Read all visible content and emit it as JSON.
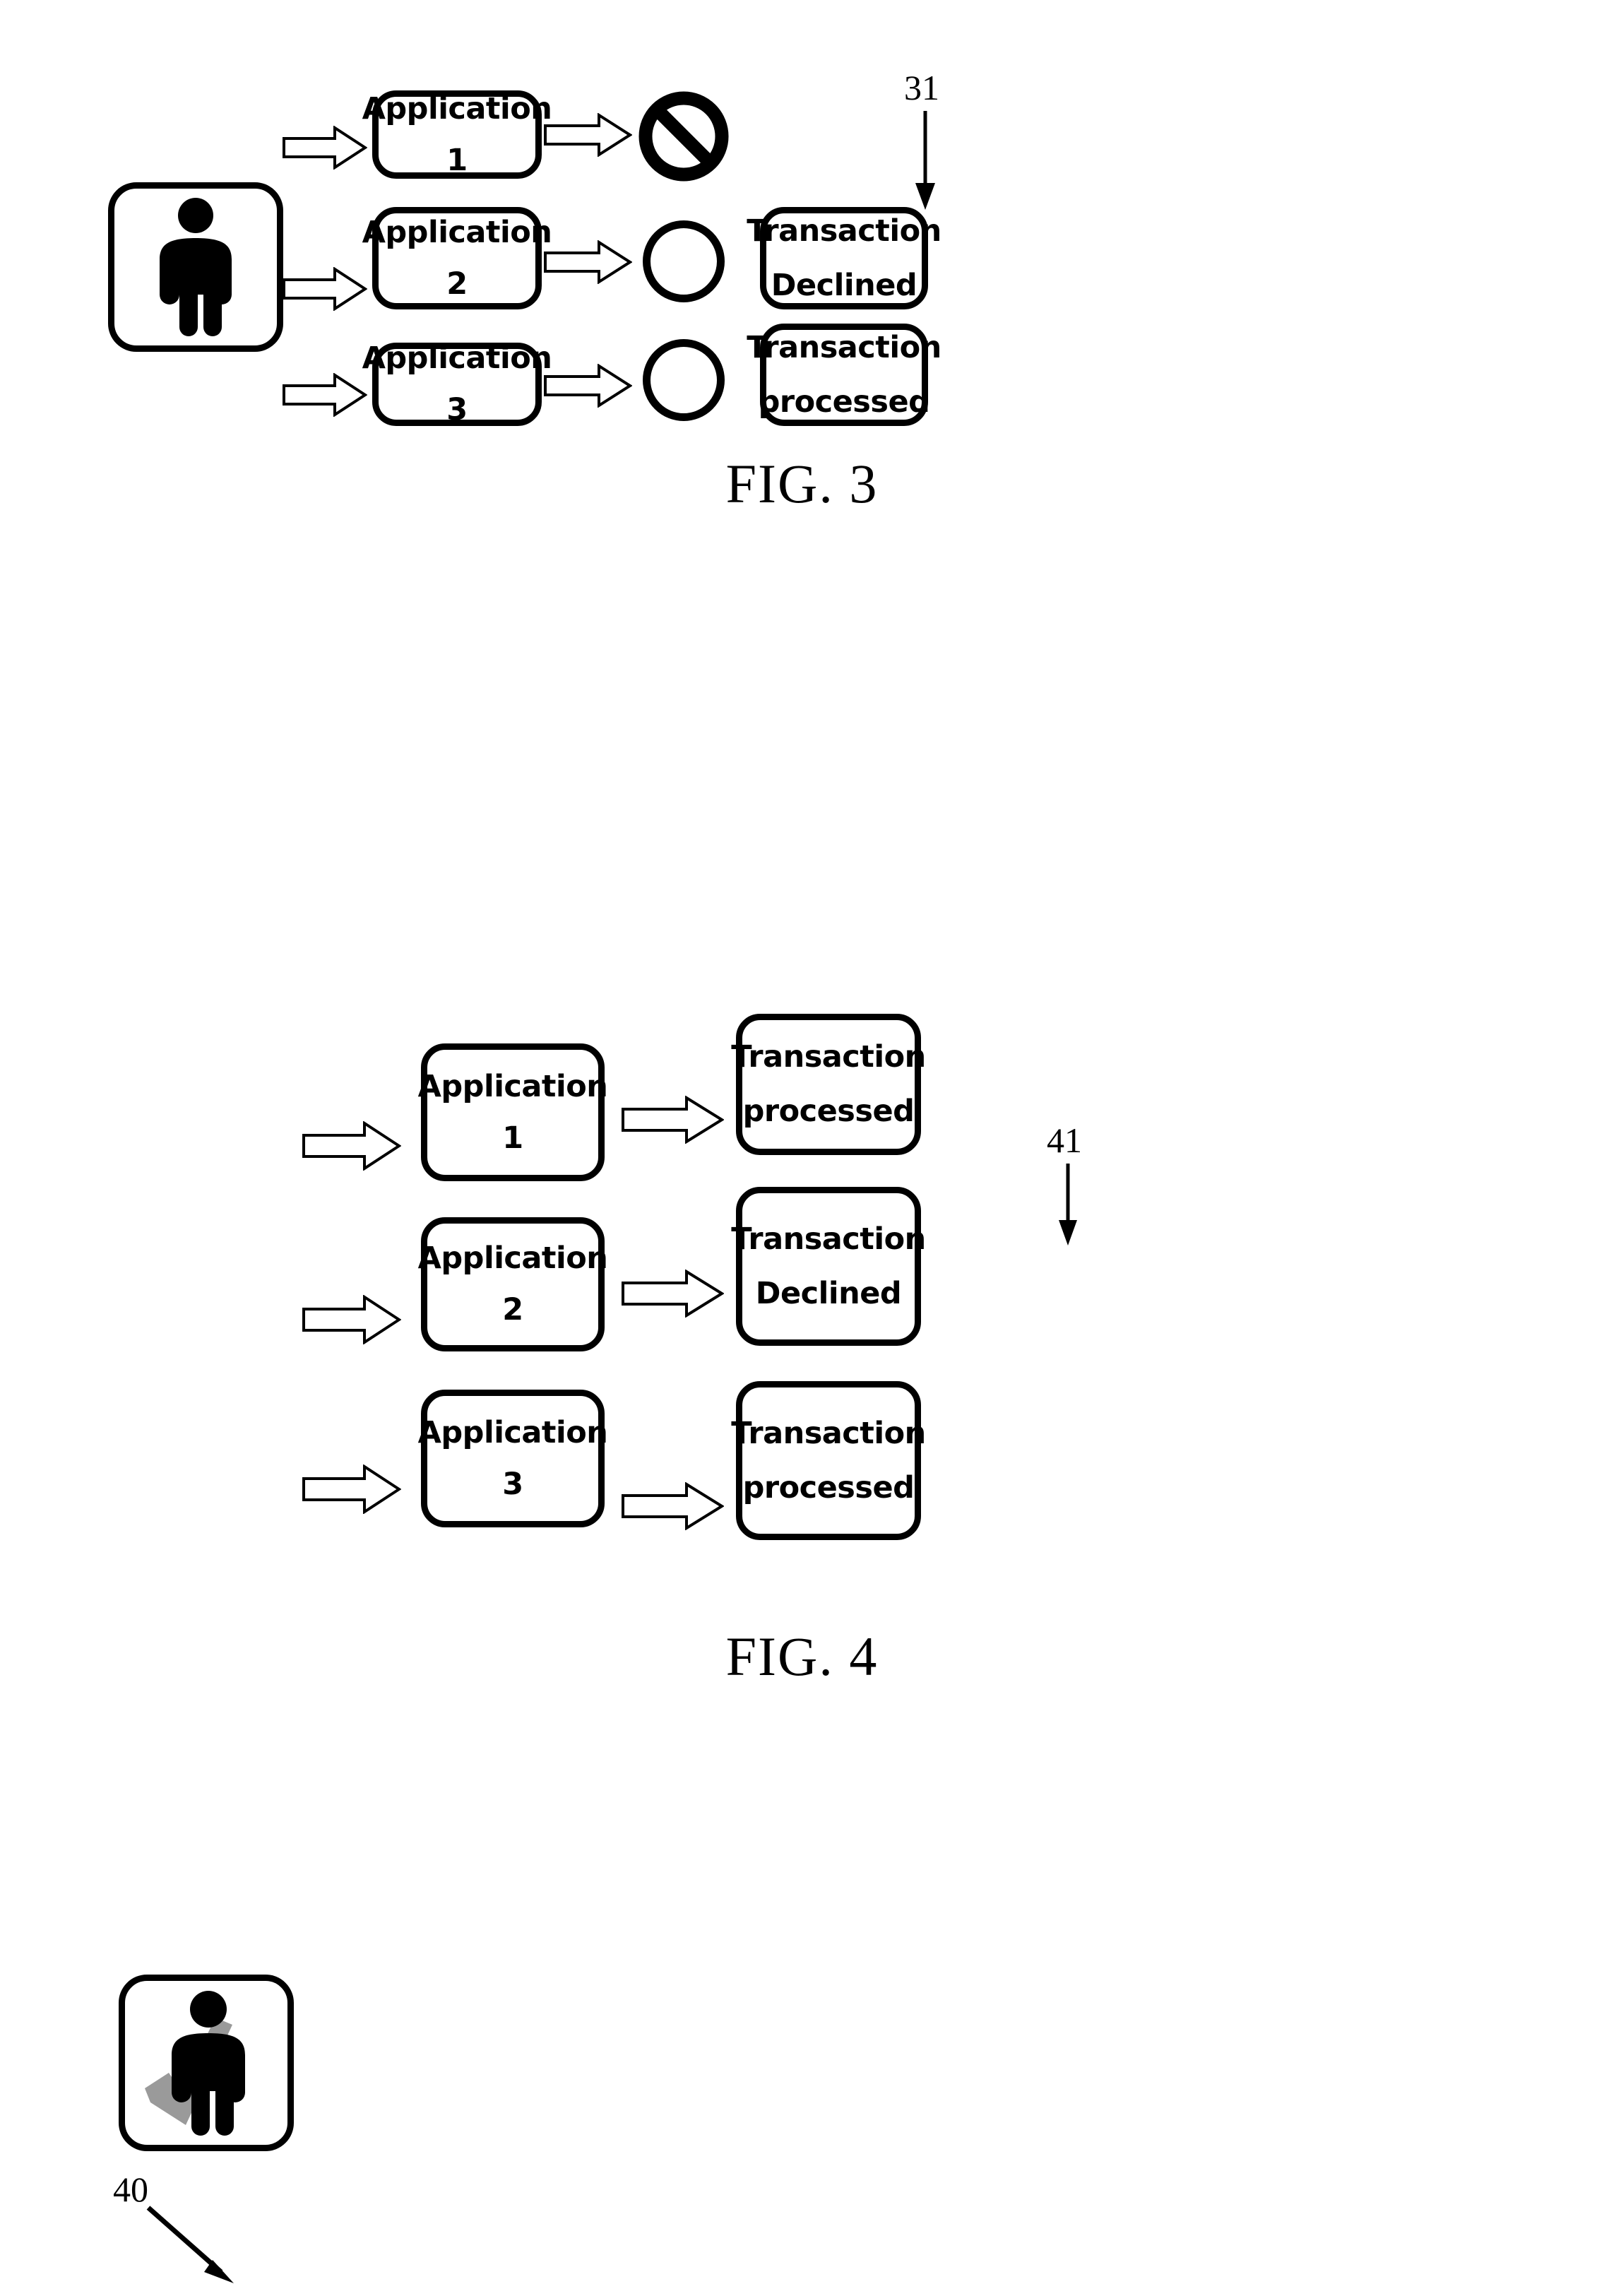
{
  "figures": [
    {
      "id": "fig3",
      "caption": "FIG. 3",
      "ref_number": "31",
      "actor": {
        "icon": "person-icon"
      },
      "applications": [
        {
          "name_line": "Application",
          "index_line": "1"
        },
        {
          "name_line": "Application",
          "index_line": "2"
        },
        {
          "name_line": "Application",
          "index_line": "3"
        }
      ],
      "indicators": [
        {
          "type": "prohibition-sign"
        },
        {
          "type": "empty-circle"
        },
        {
          "type": "empty-circle"
        }
      ],
      "outcomes": [
        {
          "line1": "Transaction",
          "line2": "Declined"
        },
        {
          "line1": "Transaction",
          "line2": "processed"
        }
      ]
    },
    {
      "id": "fig4",
      "caption": "FIG. 4",
      "ref_number": "41",
      "actor_ref_number": "40",
      "actor": {
        "icon": "person-icon",
        "badge": "check-mark"
      },
      "applications": [
        {
          "name_line": "Application",
          "index_line": "1"
        },
        {
          "name_line": "Application",
          "index_line": "2"
        },
        {
          "name_line": "Application",
          "index_line": "3"
        }
      ],
      "outcomes": [
        {
          "line1": "Transaction",
          "line2": "processed"
        },
        {
          "line1": "Transaction",
          "line2": "Declined"
        },
        {
          "line1": "Transaction",
          "line2": "processed"
        }
      ]
    }
  ],
  "colors": {
    "stroke": "#000000",
    "background": "#ffffff",
    "check_mark": "#9a9a9a"
  }
}
